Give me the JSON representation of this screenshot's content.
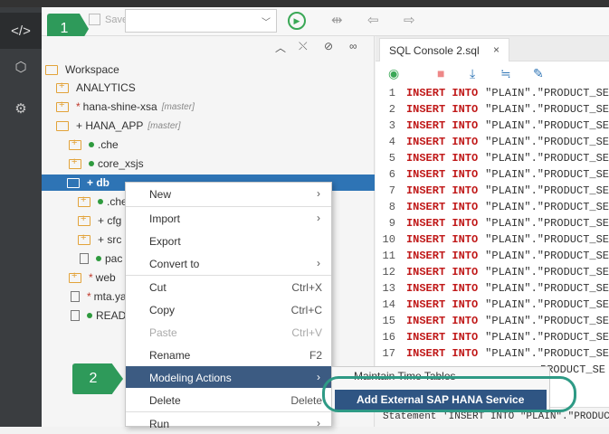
{
  "toolbar": {
    "save_label": "Save"
  },
  "callouts": {
    "one": "1",
    "two": "2"
  },
  "rail": {
    "icons": [
      "code-icon",
      "cube-icon",
      "gear-icon"
    ]
  },
  "tree": {
    "root": "Workspace",
    "items": [
      {
        "label": "ANALYTICS"
      },
      {
        "label": "hana-shine-xsa",
        "tag": "[master]"
      },
      {
        "label": "+ HANA_APP",
        "tag": "[master]"
      },
      {
        "label": ".che"
      },
      {
        "label": "core_xsjs"
      },
      {
        "label": "+ db"
      },
      {
        "label": ".che"
      },
      {
        "label": "+ cfg"
      },
      {
        "label": "+ src"
      },
      {
        "label": "pac"
      },
      {
        "label": "web"
      },
      {
        "label": "mta.ya"
      },
      {
        "label": "READ"
      }
    ]
  },
  "editor": {
    "tab_label": "SQL Console 2.sql",
    "tab_close": "×",
    "lines": [
      {
        "n": "1",
        "kw1": "INSERT INTO",
        "rest": "\"PLAIN\".\"PRODUCT_SE"
      },
      {
        "n": "2",
        "kw1": "INSERT INTO",
        "rest": "\"PLAIN\".\"PRODUCT_SE"
      },
      {
        "n": "3",
        "kw1": "INSERT INTO",
        "rest": "\"PLAIN\".\"PRODUCT_SE"
      },
      {
        "n": "4",
        "kw1": "INSERT INTO",
        "rest": "\"PLAIN\".\"PRODUCT_SE"
      },
      {
        "n": "5",
        "kw1": "INSERT INTO",
        "rest": "\"PLAIN\".\"PRODUCT_SE"
      },
      {
        "n": "6",
        "kw1": "INSERT INTO",
        "rest": "\"PLAIN\".\"PRODUCT_SE"
      },
      {
        "n": "7",
        "kw1": "INSERT INTO",
        "rest": "\"PLAIN\".\"PRODUCT_SE"
      },
      {
        "n": "8",
        "kw1": "INSERT INTO",
        "rest": "\"PLAIN\".\"PRODUCT_SE"
      },
      {
        "n": "9",
        "kw1": "INSERT INTO",
        "rest": "\"PLAIN\".\"PRODUCT_SE"
      },
      {
        "n": "10",
        "kw1": "INSERT INTO",
        "rest": "\"PLAIN\".\"PRODUCT_SE"
      },
      {
        "n": "11",
        "kw1": "INSERT INTO",
        "rest": "\"PLAIN\".\"PRODUCT_SE"
      },
      {
        "n": "12",
        "kw1": "INSERT INTO",
        "rest": "\"PLAIN\".\"PRODUCT_SE"
      },
      {
        "n": "13",
        "kw1": "INSERT INTO",
        "rest": "\"PLAIN\".\"PRODUCT_SE"
      },
      {
        "n": "14",
        "kw1": "INSERT INTO",
        "rest": "\"PLAIN\".\"PRODUCT_SE"
      },
      {
        "n": "15",
        "kw1": "INSERT INTO",
        "rest": "\"PLAIN\".\"PRODUCT_SE"
      },
      {
        "n": "16",
        "kw1": "INSERT INTO",
        "rest": "\"PLAIN\".\"PRODUCT_SE"
      },
      {
        "n": "17",
        "kw1": "INSERT INTO",
        "rest": "\"PLAIN\".\"PRODUCT_SE"
      },
      {
        "n": "",
        "kw1": "",
        "rest": "PRODUCT_SE"
      }
    ],
    "status": "Statement 'INSERT INTO \"PLAIN\".\"PRODUC"
  },
  "context_menu": {
    "new": "New",
    "import": "Import",
    "export": "Export",
    "convert_to": "Convert to",
    "cut": "Cut",
    "cut_sc": "Ctrl+X",
    "copy": "Copy",
    "copy_sc": "Ctrl+C",
    "paste": "Paste",
    "paste_sc": "Ctrl+V",
    "rename": "Rename",
    "rename_sc": "F2",
    "modeling": "Modeling Actions",
    "delete": "Delete",
    "delete_sc": "Delete",
    "run": "Run"
  },
  "submenu": {
    "maintain": "Maintain Time Tables",
    "add_external": "Add External SAP HANA Service"
  },
  "colors": {
    "accent": "#2e74b5",
    "menu_highlight": "#3c5b82",
    "callout": "#2e9a5a",
    "keyword": "#c01818"
  }
}
